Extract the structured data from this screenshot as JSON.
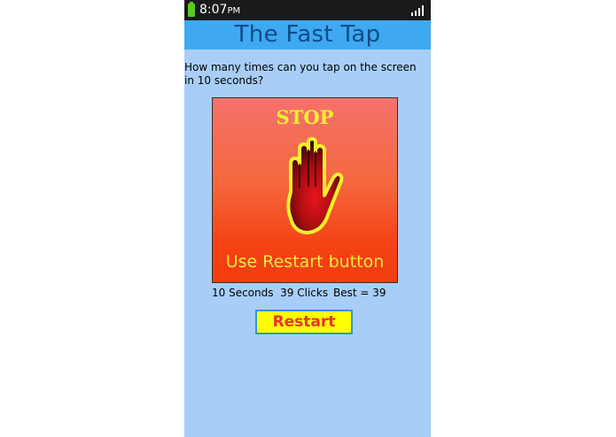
{
  "status_bar": {
    "time": "8:07",
    "ampm": "PM",
    "icons": [
      "battery-icon",
      "signal-icon"
    ]
  },
  "app": {
    "title": "The Fast Tap"
  },
  "main": {
    "question": "How many times can you tap on the screen in 10 seconds?",
    "tap_area": {
      "stop_text": "STOP",
      "icon": "hand-stop-icon",
      "hint": "Use Restart button"
    },
    "stats": {
      "seconds": "10 Seconds",
      "clicks": "39 Clicks",
      "best": "Best = 39"
    },
    "restart_label": "Restart"
  },
  "colors": {
    "status_bar": "#1a1a1a",
    "title_bar": "#3ea9f1",
    "title_text": "#0d4c8a",
    "background": "#a8cef7",
    "button_bg": "#ffff00",
    "button_text": "#e8342a",
    "stop_yellow": "#f5ef2c"
  }
}
